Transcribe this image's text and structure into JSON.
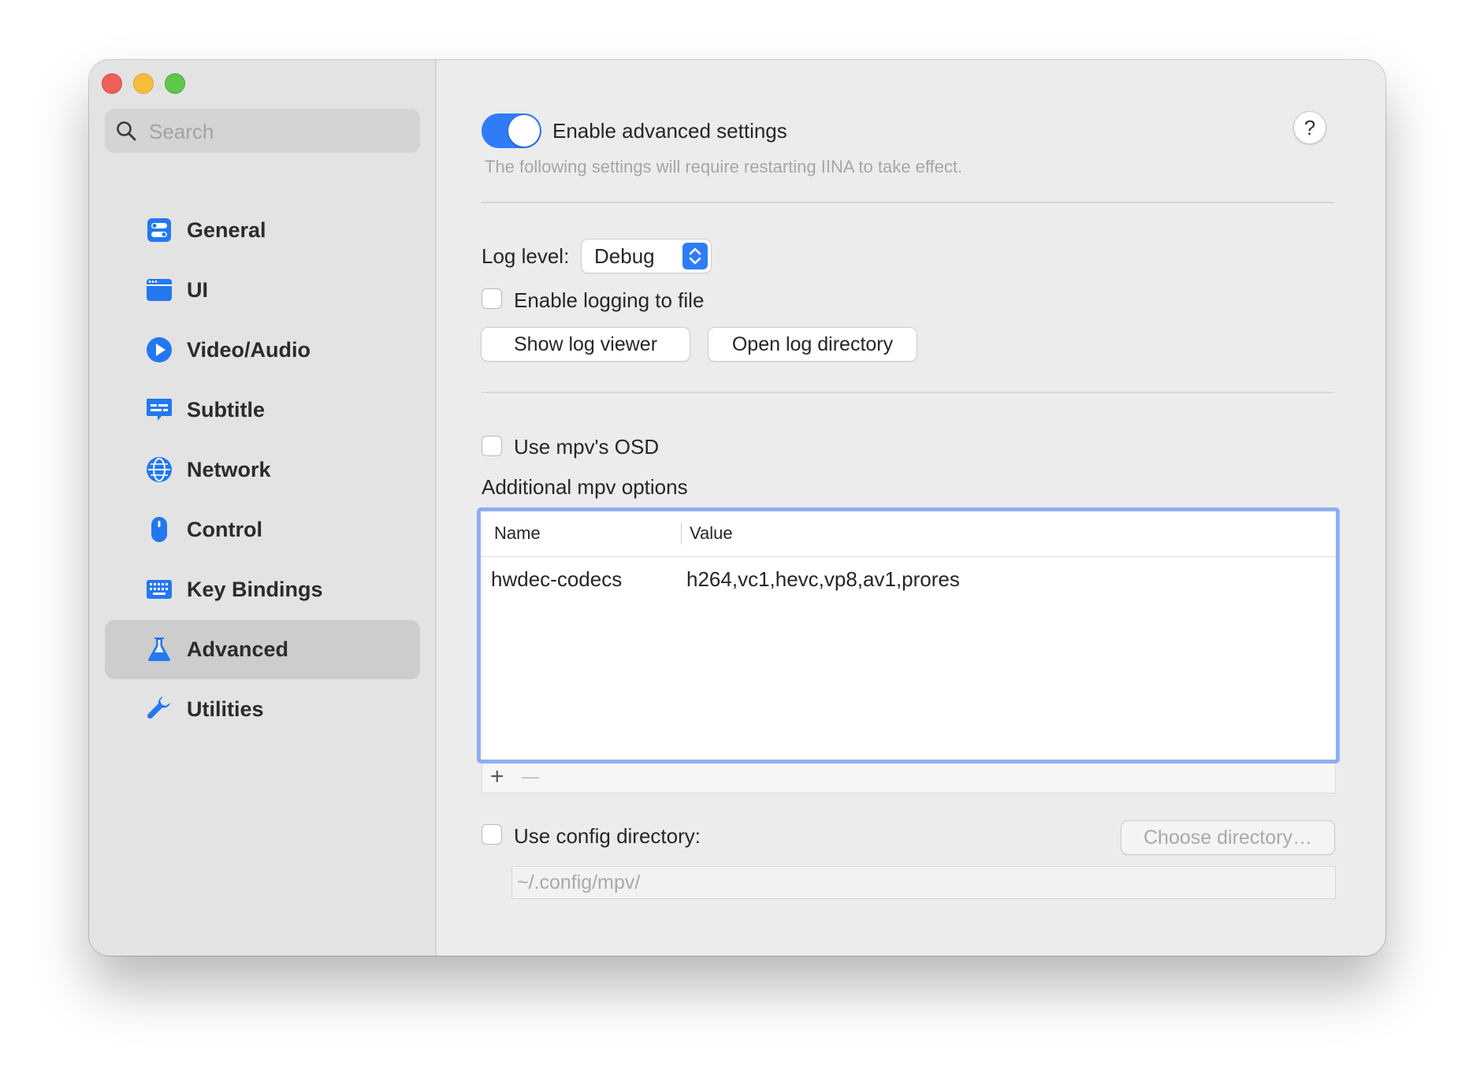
{
  "window": {
    "traffic_lights": {
      "close": "#ee5f57",
      "minimize": "#f6bd3b",
      "maximize": "#5fc74b"
    }
  },
  "sidebar": {
    "search": {
      "placeholder": "Search",
      "value": "",
      "icon": "search-icon"
    },
    "items": [
      {
        "label": "General",
        "icon": "toggles-icon",
        "selected": false
      },
      {
        "label": "UI",
        "icon": "window-icon",
        "selected": false
      },
      {
        "label": "Video/Audio",
        "icon": "play-circle-icon",
        "selected": false
      },
      {
        "label": "Subtitle",
        "icon": "caption-bubble-icon",
        "selected": false
      },
      {
        "label": "Network",
        "icon": "globe-icon",
        "selected": false
      },
      {
        "label": "Control",
        "icon": "mouse-icon",
        "selected": false
      },
      {
        "label": "Key Bindings",
        "icon": "keyboard-icon",
        "selected": false
      },
      {
        "label": "Advanced",
        "icon": "flask-icon",
        "selected": true
      },
      {
        "label": "Utilities",
        "icon": "wrench-icon",
        "selected": false
      }
    ]
  },
  "advanced": {
    "enable": {
      "label": "Enable advanced settings",
      "on": true,
      "note": "The following settings will require restarting IINA to take effect."
    },
    "help_label": "?",
    "log_level": {
      "label": "Log level:",
      "value": "Debug"
    },
    "enable_logging": {
      "label": "Enable logging to file",
      "checked": false
    },
    "show_log_viewer": "Show log viewer",
    "open_log_directory": "Open log directory",
    "use_mpv_osd": {
      "label": "Use mpv's OSD",
      "checked": false
    },
    "mpv_options": {
      "title": "Additional mpv options",
      "columns": [
        "Name",
        "Value"
      ],
      "rows": [
        {
          "name": "hwdec-codecs",
          "value": "h264,vc1,hevc,vp8,av1,prores"
        }
      ],
      "add_label": "+",
      "remove_label": "—"
    },
    "config_dir": {
      "label": "Use config directory:",
      "checked": false,
      "choose_label": "Choose directory…",
      "path": "~/.config/mpv/"
    }
  },
  "colors": {
    "accent": "#2f7cf6",
    "focus_ring": "#8faef1",
    "icon_blue": "#2378f0"
  }
}
